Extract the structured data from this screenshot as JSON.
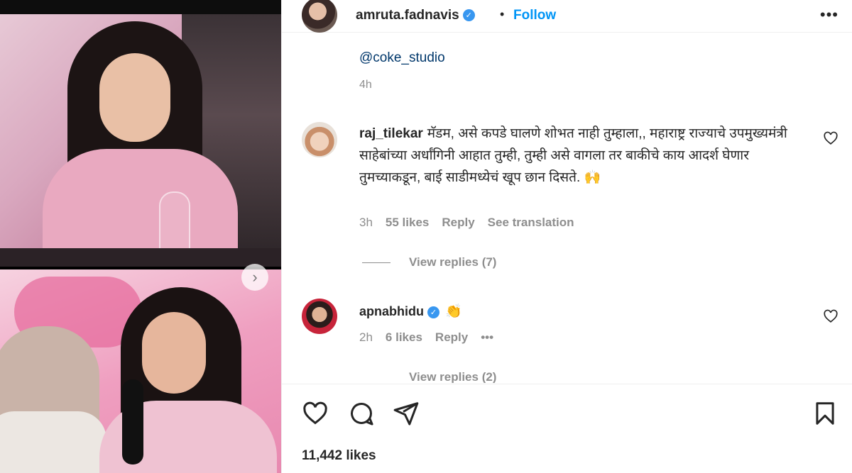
{
  "post": {
    "username": "amruta.fadnavis",
    "verified": true,
    "follow_label": "Follow",
    "separator": "•",
    "more_label": "•••",
    "caption_mention": "@coke_studio",
    "caption_time": "4h",
    "likes_count": "11,442 likes",
    "carousel_next": "›"
  },
  "comments": [
    {
      "username": "raj_tilekar",
      "text": "मॅडम, असे कपडे घालणे शोभत नाही तुम्हाला,, महाराष्ट्र राज्याचे उपमुख्यमंत्री साहेबांच्या अर्धांगिनी आहात तुम्ही, तुम्ही असे वागला तर बाकीचे काय आदर्श घेणार तुमच्याकडून, बाई साडीमध्येचं खूप छान दिसते. 🙌",
      "time": "3h",
      "likes": "55 likes",
      "reply_label": "Reply",
      "translation_label": "See translation",
      "view_replies": "View replies (7)"
    },
    {
      "username": "apnabhidu",
      "verified": true,
      "text": "👏",
      "time": "2h",
      "likes": "6 likes",
      "reply_label": "Reply",
      "more_label": "•••",
      "view_replies": "View replies (2)"
    }
  ],
  "colors": {
    "follow": "#0095f6",
    "verified": "#3897f0",
    "mention": "#00376b",
    "muted": "#8e8e8e",
    "text": "#262626"
  },
  "icons": [
    "heart-icon",
    "comment-icon",
    "share-icon",
    "bookmark-icon",
    "verified-badge-icon",
    "more-options-icon",
    "chevron-right-icon"
  ]
}
